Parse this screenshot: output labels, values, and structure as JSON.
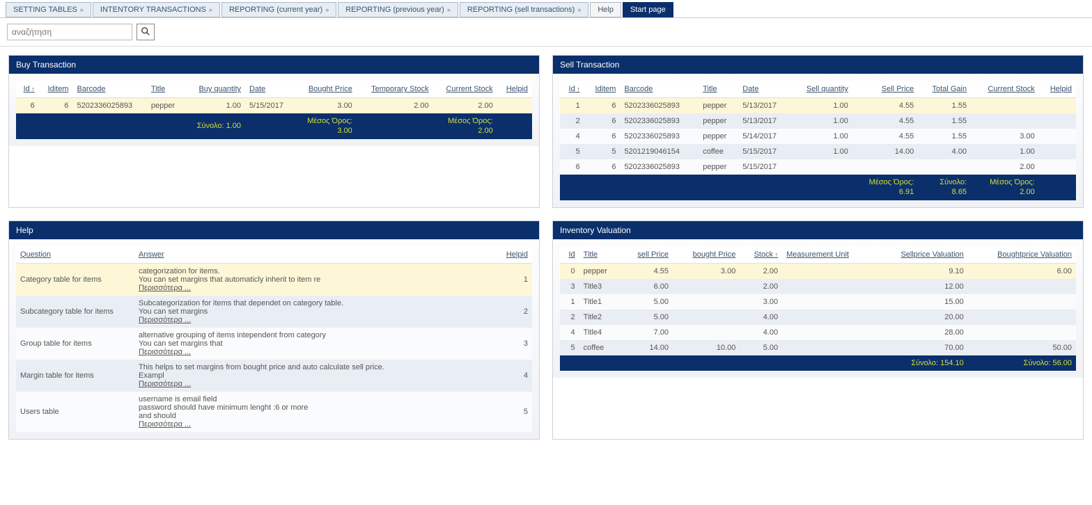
{
  "tabs": [
    {
      "label": "SETTING TABLES",
      "type": "drop"
    },
    {
      "label": "INTENTORY TRANSACTIONS",
      "type": "drop"
    },
    {
      "label": "REPORTING (current year)",
      "type": "drop"
    },
    {
      "label": "REPORTING (previous year)",
      "type": "drop"
    },
    {
      "label": "REPORTING (sell transactions)",
      "type": "drop"
    },
    {
      "label": "Help",
      "type": "plain"
    },
    {
      "label": "Start page",
      "type": "active"
    }
  ],
  "search": {
    "placeholder": "αναζήτηση"
  },
  "buy": {
    "title": "Buy Transaction",
    "cols": [
      "Id",
      "Iditem",
      "Barcode",
      "Title",
      "Buy quantity",
      "Date",
      "Bought Price",
      "Temporary Stock",
      "Current Stock",
      "Helpid"
    ],
    "rows": [
      {
        "Id": "6",
        "Iditem": "6",
        "Barcode": "5202336025893",
        "Title": "pepper",
        "Buy_quantity": "1.00",
        "Date": "5/15/2017",
        "Bought_Price": "3.00",
        "Temporary_Stock": "2.00",
        "Current_Stock": "2.00",
        "Helpid": ""
      }
    ],
    "sum_qty_label": "Σύνολο:",
    "sum_qty": "1.00",
    "avg_label": "Μέσος Όρος:",
    "avg_price": "3.00",
    "avg_stock": "2.00"
  },
  "sell": {
    "title": "Sell Transaction",
    "cols": [
      "Id",
      "Iditem",
      "Barcode",
      "Title",
      "Date",
      "Sell quantity",
      "Sell Price",
      "Total Gain",
      "Current Stock",
      "Helpid"
    ],
    "rows": [
      {
        "Id": "1",
        "Iditem": "6",
        "Barcode": "5202336025893",
        "Title": "pepper",
        "Date": "5/13/2017",
        "Sell_quantity": "1.00",
        "Sell_Price": "4.55",
        "Total_Gain": "1.55",
        "Current_Stock": "",
        "Helpid": ""
      },
      {
        "Id": "2",
        "Iditem": "6",
        "Barcode": "5202336025893",
        "Title": "pepper",
        "Date": "5/13/2017",
        "Sell_quantity": "1.00",
        "Sell_Price": "4.55",
        "Total_Gain": "1.55",
        "Current_Stock": "",
        "Helpid": ""
      },
      {
        "Id": "4",
        "Iditem": "6",
        "Barcode": "5202336025893",
        "Title": "pepper",
        "Date": "5/14/2017",
        "Sell_quantity": "1.00",
        "Sell_Price": "4.55",
        "Total_Gain": "1.55",
        "Current_Stock": "3.00",
        "Helpid": ""
      },
      {
        "Id": "5",
        "Iditem": "5",
        "Barcode": "5201219046154",
        "Title": "coffee",
        "Date": "5/15/2017",
        "Sell_quantity": "1.00",
        "Sell_Price": "14.00",
        "Total_Gain": "4.00",
        "Current_Stock": "1.00",
        "Helpid": ""
      },
      {
        "Id": "6",
        "Iditem": "6",
        "Barcode": "5202336025893",
        "Title": "pepper",
        "Date": "5/15/2017",
        "Sell_quantity": "",
        "Sell_Price": "",
        "Total_Gain": "",
        "Current_Stock": "2.00",
        "Helpid": ""
      }
    ],
    "avg_label": "Μέσος Όρος:",
    "sum_label": "Σύνολο:",
    "avg_price": "6.91",
    "sum_gain": "8.65",
    "avg_stock": "2.00"
  },
  "help": {
    "title": "Help",
    "cols": [
      "Question",
      "Answer",
      "Helpid"
    ],
    "more": "Περισσότερα ...",
    "rows": [
      {
        "q": "Category table for items",
        "a1": "categorization for items.",
        "a2": "You can set margins that automaticly inherit to item re",
        "id": "1"
      },
      {
        "q": "Subcategory table for items",
        "a1": "Subcategorization for items that dependet on category table.",
        "a2": "You can set margins",
        "id": "2"
      },
      {
        "q": "Group table for items",
        "a1": "alternative grouping of items intependent from category",
        "a2": "You can set margins that",
        "id": "3"
      },
      {
        "q": "Margin table for items",
        "a1": "This helps to set margins from bought price and auto calculate sell price.",
        "a2": "Exampl",
        "id": "4"
      },
      {
        "q": "Users table",
        "a1": "username is email field",
        "a2": "password should have minimum lenght :6 or more",
        "a3": "and should",
        "id": "5"
      }
    ]
  },
  "inv": {
    "title": "Inventory Valuation",
    "cols": [
      "Id",
      "Title",
      "sell Price",
      "bought Price",
      "Stock",
      "Measurement Unit",
      "Sellprice Valuation",
      "Boughtprice Valuation"
    ],
    "rows": [
      {
        "Id": "0",
        "Title": "pepper",
        "sell": "4.55",
        "bought": "3.00",
        "stock": "2.00",
        "mu": "",
        "sval": "9.10",
        "bval": "6.00"
      },
      {
        "Id": "3",
        "Title": "Title3",
        "sell": "6.00",
        "bought": "",
        "stock": "2.00",
        "mu": "",
        "sval": "12.00",
        "bval": ""
      },
      {
        "Id": "1",
        "Title": "Title1",
        "sell": "5.00",
        "bought": "",
        "stock": "3.00",
        "mu": "",
        "sval": "15.00",
        "bval": ""
      },
      {
        "Id": "2",
        "Title": "Title2",
        "sell": "5.00",
        "bought": "",
        "stock": "4.00",
        "mu": "",
        "sval": "20.00",
        "bval": ""
      },
      {
        "Id": "4",
        "Title": "Title4",
        "sell": "7.00",
        "bought": "",
        "stock": "4.00",
        "mu": "",
        "sval": "28.00",
        "bval": ""
      },
      {
        "Id": "5",
        "Title": "coffee",
        "sell": "14.00",
        "bought": "10.00",
        "stock": "5.00",
        "mu": "",
        "sval": "70.00",
        "bval": "50.00"
      }
    ],
    "sum_label": "Σύνολο:",
    "sum_sval": "154.10",
    "sum_bval": "56.00"
  }
}
